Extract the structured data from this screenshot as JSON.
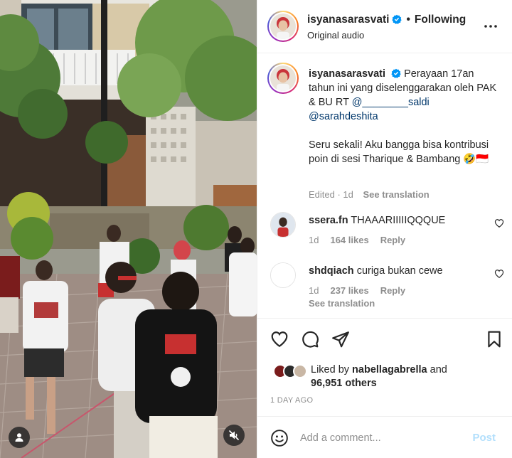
{
  "post": {
    "author": "isyanasarasvati",
    "verified": true,
    "follow_state": "Following",
    "dot": "•",
    "audio_label": "Original audio"
  },
  "caption": {
    "username": "isyanasarasvati",
    "line1": "Perayaan 17an tahun ini yang diselenggarakan oleh PAK & BU RT ",
    "mention1": "@________saldi",
    "mention2": "@sarahdeshita",
    "line2": "Seru sekali! Aku bangga bisa kontribusi poin di sesi Tharique & Bambang 🤣🇮🇩",
    "time": "Edited · 1d",
    "see_translation": "See translation"
  },
  "comments": [
    {
      "username": "ssera.fn",
      "text": "THAAARIIIIIQQQUE",
      "time": "1d",
      "likes": "164 likes",
      "reply": "Reply"
    },
    {
      "username": "shdqiach",
      "text": "curiga bukan cewe",
      "time": "1d",
      "likes": "237 likes",
      "reply": "Reply",
      "see_translation": "See translation"
    }
  ],
  "likes": {
    "prefix": "Liked by ",
    "user": "nabellagabrella",
    "suffix": " and",
    "others": "96,951 others"
  },
  "timestamp": "1 DAY AGO",
  "add_comment": {
    "placeholder": "Add a comment...",
    "post_label": "Post"
  },
  "colors": {
    "verified_blue": "#0095f6",
    "post_disabled": "#b2dffc",
    "muted_text": "#8e8e8e",
    "mention_blue": "#00376b"
  },
  "icons": {
    "header": "more-options-icon",
    "actions": [
      "like-heart-icon",
      "comment-bubble-icon",
      "share-plane-icon",
      "save-bookmark-icon"
    ],
    "media": [
      "user-tag-icon",
      "muted-speaker-icon"
    ]
  }
}
